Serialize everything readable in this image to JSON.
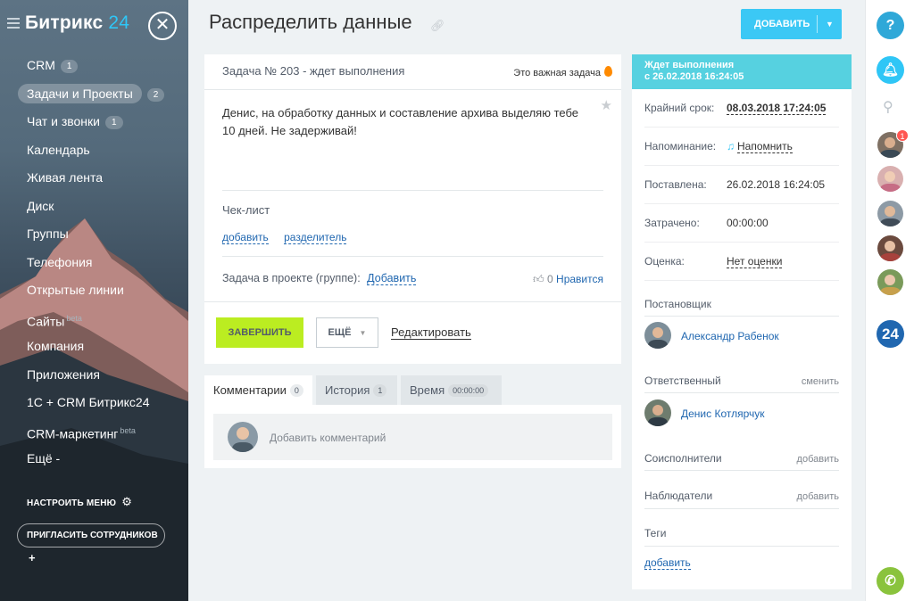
{
  "app": {
    "name": "Битрикс",
    "name_suffix": "24"
  },
  "sidebar": {
    "items": [
      {
        "label": "CRM",
        "count": "1"
      },
      {
        "label": "Задачи и Проекты",
        "count": "2",
        "active": true
      },
      {
        "label": "Чат и звонки",
        "count": "1"
      },
      {
        "label": "Календарь"
      },
      {
        "label": "Живая лента"
      },
      {
        "label": "Диск"
      },
      {
        "label": "Группы"
      },
      {
        "label": "Телефония"
      },
      {
        "label": "Открытые линии"
      },
      {
        "label": "Сайты",
        "sup": "beta"
      },
      {
        "label": "Компания"
      },
      {
        "label": "Приложения"
      },
      {
        "label": "1С + CRM Битрикс24"
      },
      {
        "label": "CRM-маркетинг",
        "sup": "beta"
      },
      {
        "label": "Ещё -"
      }
    ],
    "configure_label": "НАСТРОИТЬ МЕНЮ",
    "invite_label": "ПРИГЛАСИТЬ СОТРУДНИКОВ"
  },
  "header": {
    "title": "Распределить данные",
    "add_label": "ДОБАВИТЬ"
  },
  "task": {
    "heading": "Задача № 203 - ждет выполнения",
    "important_label": "Это важная задача",
    "description": "Денис, на обработку данных и составление архива выделяю тебе 10 дней. Не задерживай!",
    "checklist_title": "Чек-лист",
    "checklist_add": "добавить",
    "checklist_separator": "разделитель",
    "project_label": "Задача в проекте (группе):",
    "project_add": "Добавить",
    "likes_count": "0",
    "like_label": "Нравится",
    "complete_label": "ЗАВЕРШИТЬ",
    "more_label": "ЕЩЁ",
    "edit_label": "Редактировать"
  },
  "tabs": [
    {
      "label": "Комментарии",
      "count": "0"
    },
    {
      "label": "История",
      "count": "1"
    },
    {
      "label": "Время",
      "count": "00:00:00"
    }
  ],
  "comments": {
    "placeholder": "Добавить комментарий"
  },
  "status": {
    "line1": "Ждет выполнения",
    "line2": "с 26.02.2018 16:24:05"
  },
  "details": {
    "deadline_label": "Крайний срок:",
    "deadline_value": "08.03.2018 17:24:05",
    "reminder_label": "Напоминание:",
    "reminder_value": "Напомнить",
    "created_label": "Поставлена:",
    "created_value": "26.02.2018 16:24:05",
    "spent_label": "Затрачено:",
    "spent_value": "00:00:00",
    "rating_label": "Оценка:",
    "rating_value": "Нет оценки",
    "creator_title": "Постановщик",
    "creator_name": "Александр Рабенок",
    "responsible_title": "Ответственный",
    "responsible_change": "сменить",
    "responsible_name": "Денис Котлярчук",
    "coexec_title": "Соисполнители",
    "coexec_add": "добавить",
    "observers_title": "Наблюдатели",
    "observers_add": "добавить",
    "tags_title": "Теги",
    "tags_add": "добавить"
  },
  "right_bar": {
    "help": "?",
    "notif_count": "1",
    "brand": "24"
  },
  "colors": {
    "accent": "#3bc8f5",
    "complete": "#bbed21",
    "status": "#56d1e0",
    "link": "#2067b0"
  }
}
